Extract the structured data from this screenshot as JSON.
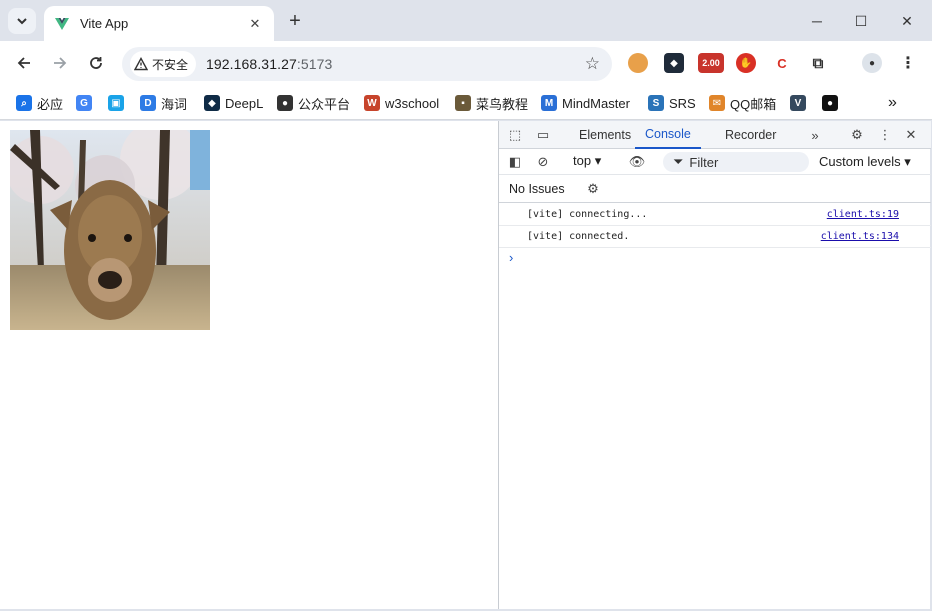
{
  "tab": {
    "title": "Vite App"
  },
  "address": {
    "security_label": "不安全",
    "host": "192.168.31.27",
    "port": ":5173"
  },
  "extensions": {
    "badge": "2.00"
  },
  "bookmarks": [
    {
      "label": "必应",
      "icon": "search-icon",
      "color": "#1a73e8"
    },
    {
      "label": "",
      "icon": "google-icon",
      "color": "#4285f4"
    },
    {
      "label": "",
      "icon": "bilibili-icon",
      "color": "#1aa3e8"
    },
    {
      "label": "海词",
      "icon": "dict-icon",
      "color": "#2d7be5"
    },
    {
      "label": "DeepL",
      "icon": "deepl-icon",
      "color": "#0f2b46"
    },
    {
      "label": "公众平台",
      "icon": "wechat-icon",
      "color": "#333333"
    },
    {
      "label": "w3school",
      "icon": "w3school-icon",
      "color": "#c7442b"
    },
    {
      "label": "菜鸟教程",
      "icon": "runoob-icon",
      "color": "#6b5a3a"
    },
    {
      "label": "MindMaster",
      "icon": "mindmaster-icon",
      "color": "#2a6fd6"
    },
    {
      "label": "SRS",
      "icon": "srs-icon",
      "color": "#2a73b8"
    },
    {
      "label": "QQ邮箱",
      "icon": "qqmail-icon",
      "color": "#e0852a"
    },
    {
      "label": "",
      "icon": "vue-icon",
      "color": "#35495e"
    },
    {
      "label": "",
      "icon": "github-icon",
      "color": "#111111"
    }
  ],
  "devtools": {
    "tabs": [
      "Elements",
      "Console",
      "Recorder"
    ],
    "active_tab": "Console",
    "context": "top",
    "filter_placeholder": "Filter",
    "levels": "Custom levels",
    "issues": "No Issues",
    "messages": [
      {
        "text": "[vite] connecting...",
        "source": "client.ts:19"
      },
      {
        "text": "[vite] connected.",
        "source": "client.ts:134"
      }
    ]
  },
  "colors": {
    "accent": "#1a57c9",
    "chrome_bg": "#dfe3eb"
  }
}
